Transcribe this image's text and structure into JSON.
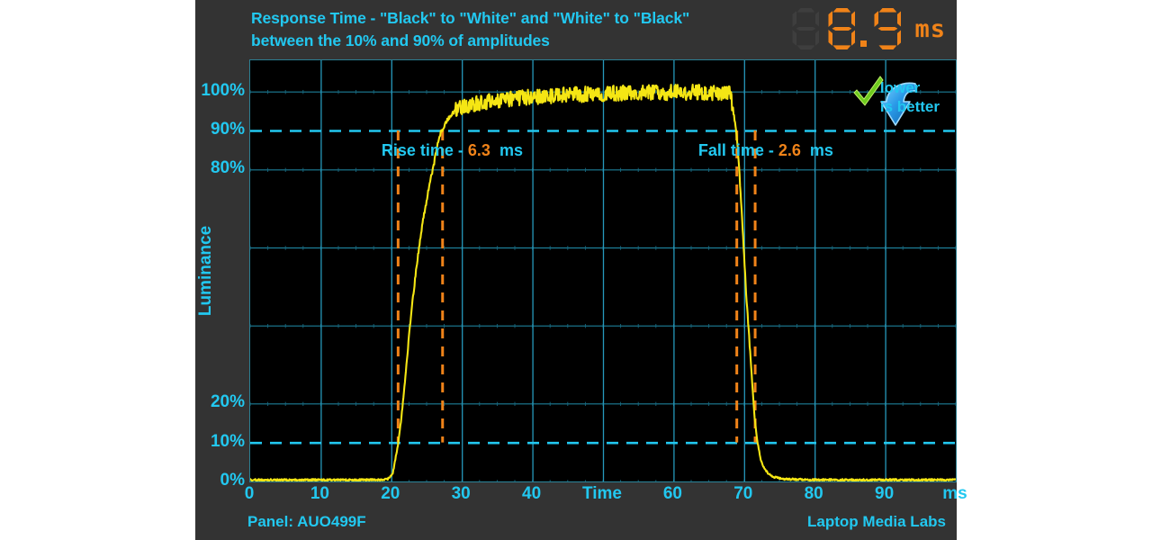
{
  "title": {
    "line1": "Response Time - \"Black\" to \"White\" and \"White\" to \"Black\"",
    "line2": "between the 10% and 90% of amplitudes"
  },
  "readout": {
    "value": "8.9",
    "unit": "ms",
    "digits": [
      "off",
      "8",
      "9"
    ]
  },
  "legend": {
    "line1": "lower",
    "line2": "is better",
    "arrow_icon": "down-arrow-icon",
    "check_icon": "green-check-icon"
  },
  "annotations": {
    "rise": {
      "label": "Rise time -",
      "value": "6.3",
      "unit": "ms"
    },
    "fall": {
      "label": "Fall time -",
      "value": "2.6",
      "unit": "ms"
    }
  },
  "footer": {
    "panel": "Panel: AUO499F",
    "credit": "Laptop Media Labs"
  },
  "colors": {
    "cyan": "#22c8f0",
    "orange": "#f08319",
    "curve": "#f5e614",
    "grid": "#1f6f86",
    "grid_major": "#2fa8c8",
    "panel_bg": "#333333",
    "plot_bg": "#000000",
    "green": "#6ecb1e",
    "arrow_blue": "#1f8fe0"
  },
  "chart_data": {
    "type": "line",
    "title": "Response Time - \"Black\" to \"White\" and \"White\" to \"Black\" between the 10% and 90% of amplitudes",
    "xlabel": "Time",
    "ylabel": "Luminance",
    "x_unit": "ms",
    "y_unit": "%",
    "xlim": [
      0,
      100
    ],
    "ylim": [
      0,
      108
    ],
    "grid": true,
    "legend_position": "top-right",
    "x_ticks": [
      0,
      10,
      20,
      30,
      40,
      50,
      60,
      70,
      80,
      90,
      100
    ],
    "x_tick_labels": [
      "0",
      "10",
      "20",
      "30",
      "40",
      "Time",
      "60",
      "70",
      "80",
      "90",
      "ms"
    ],
    "y_ticks": [
      0,
      10,
      20,
      80,
      90,
      100
    ],
    "y_tick_labels": [
      "0%",
      "10%",
      "20%",
      "80%",
      "90%",
      "100%"
    ],
    "reference_lines": [
      {
        "axis": "y",
        "value": 10,
        "style": "dashed",
        "color": "#22c8f0"
      },
      {
        "axis": "y",
        "value": 90,
        "style": "dashed",
        "color": "#22c8f0"
      }
    ],
    "markers": [
      {
        "axis": "x",
        "value": 20.9,
        "style": "dashed",
        "color": "#f08319",
        "label": "rise-start-10pct"
      },
      {
        "axis": "x",
        "value": 27.2,
        "style": "dashed",
        "color": "#f08319",
        "label": "rise-end-90pct"
      },
      {
        "axis": "x",
        "value": 68.9,
        "style": "dashed",
        "color": "#f08319",
        "label": "fall-start-90pct"
      },
      {
        "axis": "x",
        "value": 71.5,
        "style": "dashed",
        "color": "#f08319",
        "label": "fall-end-10pct"
      }
    ],
    "measurements": {
      "rise_time_ms": 6.3,
      "fall_time_ms": 2.6,
      "total_response_time_ms": 8.9
    },
    "series": [
      {
        "name": "Luminance",
        "color": "#f5e614",
        "x": [
          0,
          2,
          4,
          6,
          8,
          10,
          12,
          14,
          16,
          18,
          19.5,
          20.2,
          20.6,
          21,
          21.4,
          21.8,
          22.2,
          22.6,
          23,
          23.5,
          24,
          24.5,
          25,
          25.5,
          26,
          26.5,
          27,
          27.2,
          28,
          29,
          30,
          32,
          34,
          36,
          38,
          40,
          42,
          44,
          46,
          48,
          50,
          52,
          54,
          56,
          58,
          60,
          62,
          64,
          66,
          68,
          68.9,
          69.3,
          69.7,
          70,
          70.3,
          70.6,
          70.9,
          71.2,
          71.5,
          71.9,
          72.3,
          72.8,
          73.4,
          74,
          75,
          76,
          78,
          80,
          84,
          88,
          92,
          96,
          100
        ],
        "y": [
          0.4,
          0.4,
          0.4,
          0.4,
          0.4,
          0.4,
          0.4,
          0.4,
          0.4,
          0.4,
          0.6,
          2,
          6,
          10,
          16,
          23,
          31,
          39,
          46,
          54,
          61,
          67,
          72,
          77,
          81,
          86,
          89.5,
          90,
          93,
          95,
          96,
          97,
          97.5,
          98,
          98.3,
          98.6,
          98.8,
          99,
          99.2,
          99.3,
          99.4,
          99.5,
          99.6,
          99.7,
          99.7,
          99.8,
          99.8,
          99.8,
          99.7,
          99.6,
          90,
          80,
          68,
          58,
          48,
          40,
          32,
          24,
          16,
          10,
          6,
          3.5,
          2,
          1.2,
          0.8,
          0.6,
          0.5,
          0.45,
          0.4,
          0.4,
          0.4,
          0.4,
          0.4
        ]
      }
    ]
  }
}
